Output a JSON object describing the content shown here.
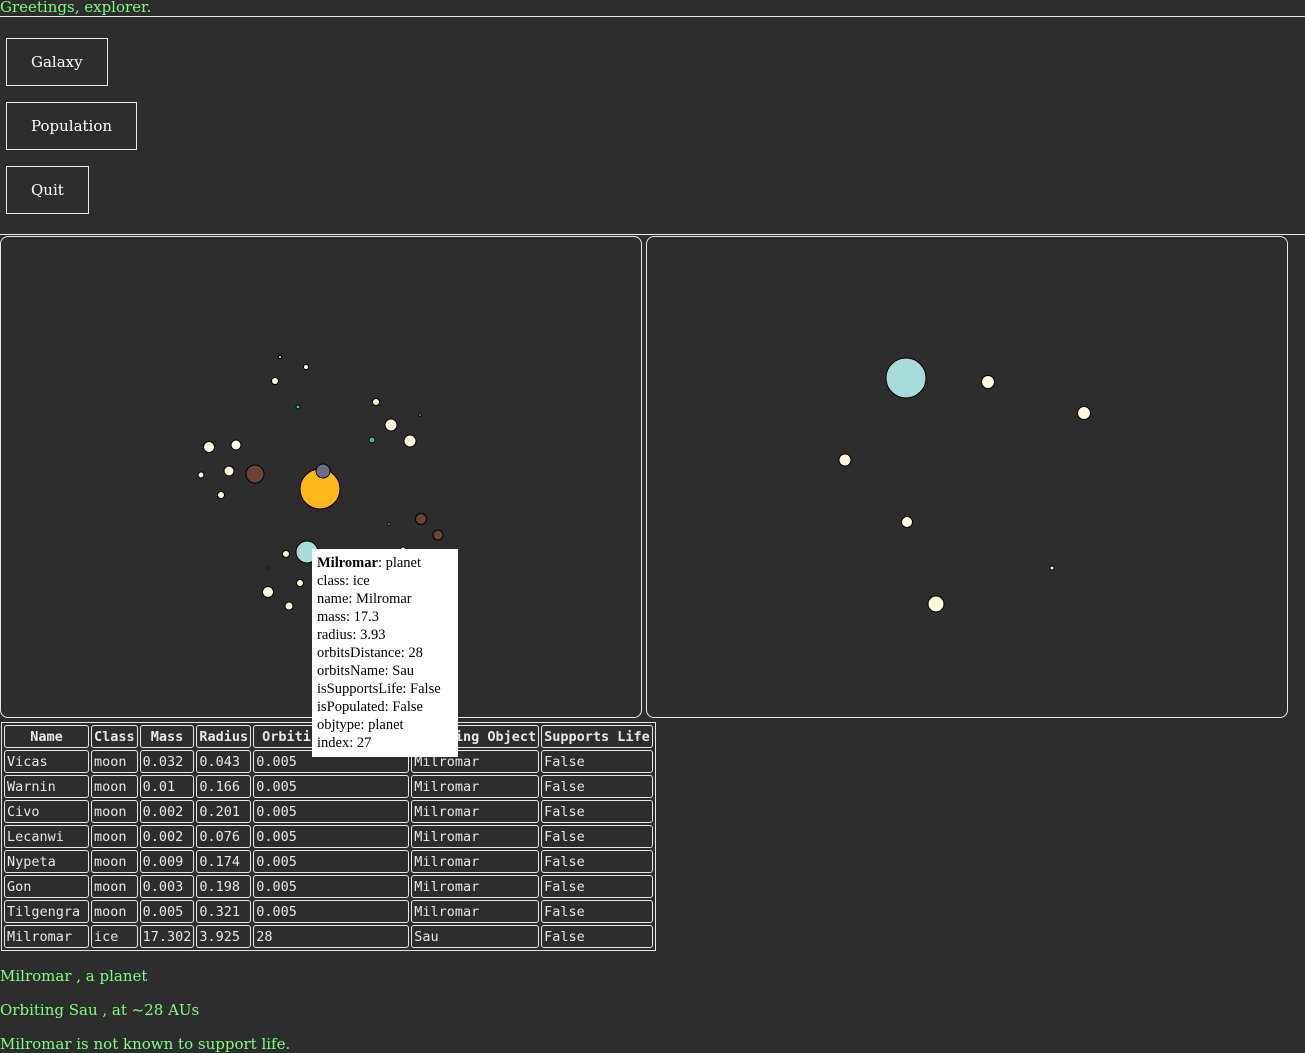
{
  "greeting": "Greetings, explorer.",
  "menu": {
    "buttons": [
      {
        "label": "Galaxy"
      },
      {
        "label": "Population"
      },
      {
        "label": "Quit"
      }
    ]
  },
  "galaxy_view": {
    "bodies": [
      {
        "class": "star",
        "color": "#ffb81c"
      },
      {
        "class": "ice",
        "color": "#a8dcd9",
        "name": "Milromar"
      },
      {
        "class": "rocky",
        "color": "#6b4433"
      },
      {
        "class": "terrestrial",
        "color": "#2cbfa5"
      },
      {
        "class": "moon",
        "color": "#fff8dc"
      }
    ]
  },
  "tooltip": {
    "title_name": "Milromar",
    "title_type": ": planet",
    "lines": [
      "class: ice",
      "name: Milromar",
      "mass: 17.3",
      "radius: 3.93",
      "orbitsDistance: 28",
      "orbitsName: Sau",
      "isSupportsLife: False",
      "isPopulated: False",
      "objtype: planet",
      "index: 27"
    ]
  },
  "table": {
    "headers": [
      "Name",
      "Class",
      "Mass",
      "Radius",
      "Orbiting Distance",
      "Orbiting Object",
      "Supports Life"
    ],
    "rows": [
      [
        "Vicas",
        "moon",
        "0.032",
        "0.043",
        "0.005",
        "Milromar",
        "False"
      ],
      [
        "Warnin",
        "moon",
        "0.01",
        "0.166",
        "0.005",
        "Milromar",
        "False"
      ],
      [
        "Civo",
        "moon",
        "0.002",
        "0.201",
        "0.005",
        "Milromar",
        "False"
      ],
      [
        "Lecanwi",
        "moon",
        "0.002",
        "0.076",
        "0.005",
        "Milromar",
        "False"
      ],
      [
        "Nypeta",
        "moon",
        "0.009",
        "0.174",
        "0.005",
        "Milromar",
        "False"
      ],
      [
        "Gon",
        "moon",
        "0.003",
        "0.198",
        "0.005",
        "Milromar",
        "False"
      ],
      [
        "Tilgengra",
        "moon",
        "0.005",
        "0.321",
        "0.005",
        "Milromar",
        "False"
      ],
      [
        "Milromar",
        "ice",
        "17.302",
        "3.925",
        "28",
        "Sau",
        "False"
      ]
    ]
  },
  "info": {
    "line1": "Milromar , a planet",
    "line2": "Orbiting Sau , at ~28 AUs",
    "line3": "Milromar is not known to support life."
  }
}
